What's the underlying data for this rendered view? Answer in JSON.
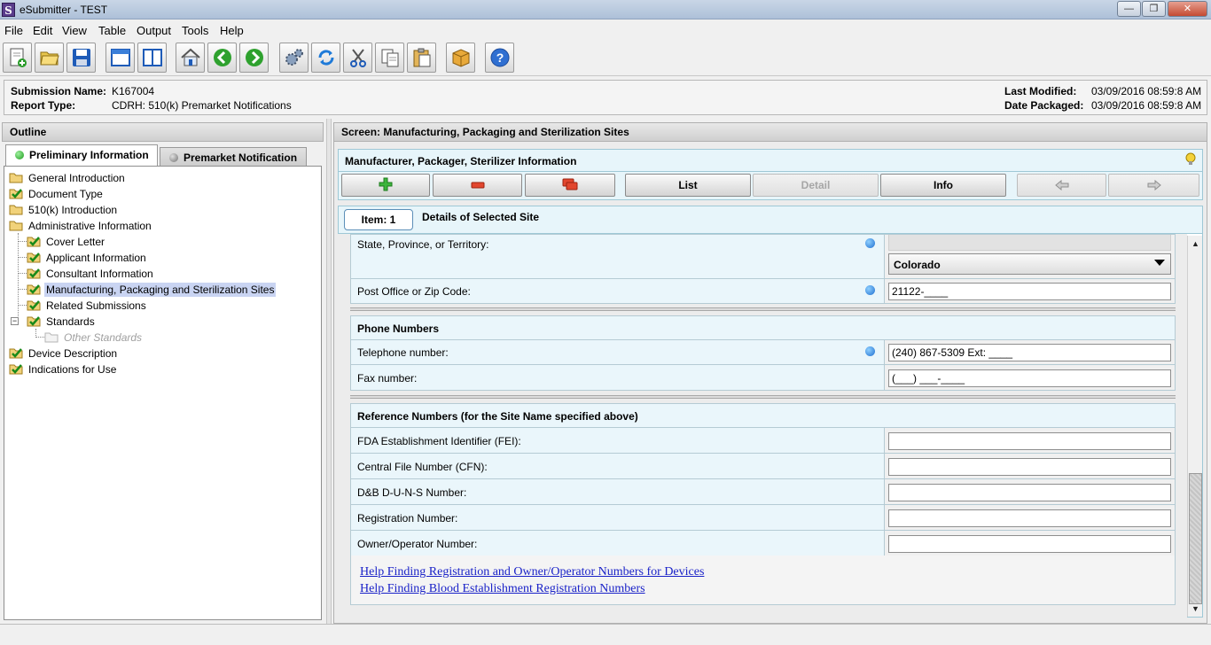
{
  "window": {
    "title": "eSubmitter - TEST",
    "app_icon_letter": "S",
    "minimize": "—",
    "maximize": "❐",
    "close": "✕"
  },
  "menu": [
    "File",
    "Edit",
    "View",
    "Table",
    "Output",
    "Tools",
    "Help"
  ],
  "toolbar_icons": [
    "new-document-icon",
    "open-folder-icon",
    "save-icon",
    "window-icon",
    "split-window-icon",
    "home-icon",
    "back-arrow-icon",
    "forward-arrow-icon",
    "settings-gears-icon",
    "refresh-icon",
    "cut-icon",
    "copy-icon",
    "paste-icon",
    "package-icon",
    "help-icon"
  ],
  "submission": {
    "name_label": "Submission Name:",
    "name_value": "K167004",
    "report_label": "Report Type:",
    "report_value": "CDRH: 510(k) Premarket Notifications",
    "modified_label": "Last Modified:",
    "modified_value": "03/09/2016 08:59:8 AM",
    "packaged_label": "Date Packaged:",
    "packaged_value": "03/09/2016 08:59:8 AM"
  },
  "outline": {
    "header": "Outline",
    "tab_active": "Preliminary Information",
    "tab_inactive": "Premarket Notification",
    "items": [
      {
        "label": "General Introduction",
        "icon": "folder"
      },
      {
        "label": "Document Type",
        "icon": "check"
      },
      {
        "label": "510(k) Introduction",
        "icon": "folder"
      },
      {
        "label": "Administrative Information",
        "icon": "folder"
      },
      {
        "label": "Cover Letter",
        "icon": "check"
      },
      {
        "label": "Applicant Information",
        "icon": "check"
      },
      {
        "label": "Consultant Information",
        "icon": "check"
      },
      {
        "label": "Manufacturing, Packaging and Sterilization Sites",
        "icon": "check"
      },
      {
        "label": "Related Submissions",
        "icon": "check"
      },
      {
        "label": "Standards",
        "icon": "check"
      },
      {
        "label": "Other Standards",
        "icon": "folder-empty"
      },
      {
        "label": "Device Description",
        "icon": "check"
      },
      {
        "label": "Indications for Use",
        "icon": "check"
      }
    ]
  },
  "screen": {
    "header": "Screen: Manufacturing, Packaging and Sterilization Sites",
    "section_title": "Manufacturer, Packager, Sterilizer Information",
    "actions": {
      "add": "",
      "remove": "",
      "copy": "",
      "list": "List",
      "detail": "Detail",
      "info": "Info",
      "prev": "",
      "next": ""
    },
    "item_tab": "Item: 1",
    "item_title": "Details of Selected Site"
  },
  "form": {
    "state_label": "State, Province, or Territory:",
    "state_value": "Colorado",
    "zip_label": "Post Office or Zip Code:",
    "zip_value": "21122-____",
    "phone_section": "Phone Numbers",
    "telephone_label": "Telephone number:",
    "telephone_value": "(240) 867-5309 Ext: ____",
    "fax_label": "Fax number:",
    "fax_value": "(___) ___-____",
    "ref_section": "Reference Numbers (for the Site Name specified above)",
    "fei_label": "FDA Establishment Identifier (FEI):",
    "fei_value": "",
    "cfn_label": "Central File Number (CFN):",
    "cfn_value": "",
    "duns_label": "D&B D-U-N-S Number:",
    "duns_value": "",
    "reg_label": "Registration Number:",
    "reg_value": "",
    "owner_label": "Owner/Operator Number:",
    "owner_value": "",
    "link1": "Help Finding Registration and Owner/Operator Numbers for Devices",
    "link2": "Help Finding Blood Establishment Registration Numbers"
  },
  "colors": {
    "accent": "#1f6fd0",
    "link": "#1a22c8",
    "panel": "#eaf6fb",
    "selection": "#c9d4f2"
  }
}
